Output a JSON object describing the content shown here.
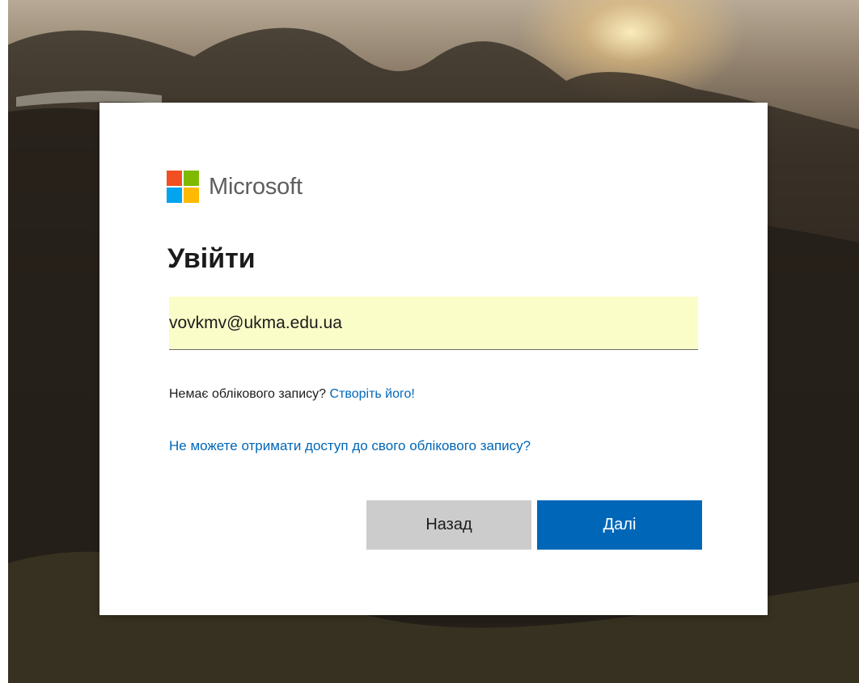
{
  "brand": {
    "name": "Microsoft",
    "colors": {
      "red": "#f25022",
      "green": "#7fba00",
      "blue": "#00a4ef",
      "yellow": "#ffb900"
    }
  },
  "signin": {
    "title": "Увійти",
    "email_value": "vovkmv@ukma.edu.ua",
    "no_account_text": "Немає облікового запису?",
    "create_link": "Створіть його!",
    "cant_access_link": "Не можете отримати доступ до свого облікового запису?",
    "back_button": "Назад",
    "next_button": "Далі"
  },
  "theme": {
    "accent": "#0067b8",
    "field_bg": "#fafdc8",
    "back_bg": "#cccccc"
  }
}
